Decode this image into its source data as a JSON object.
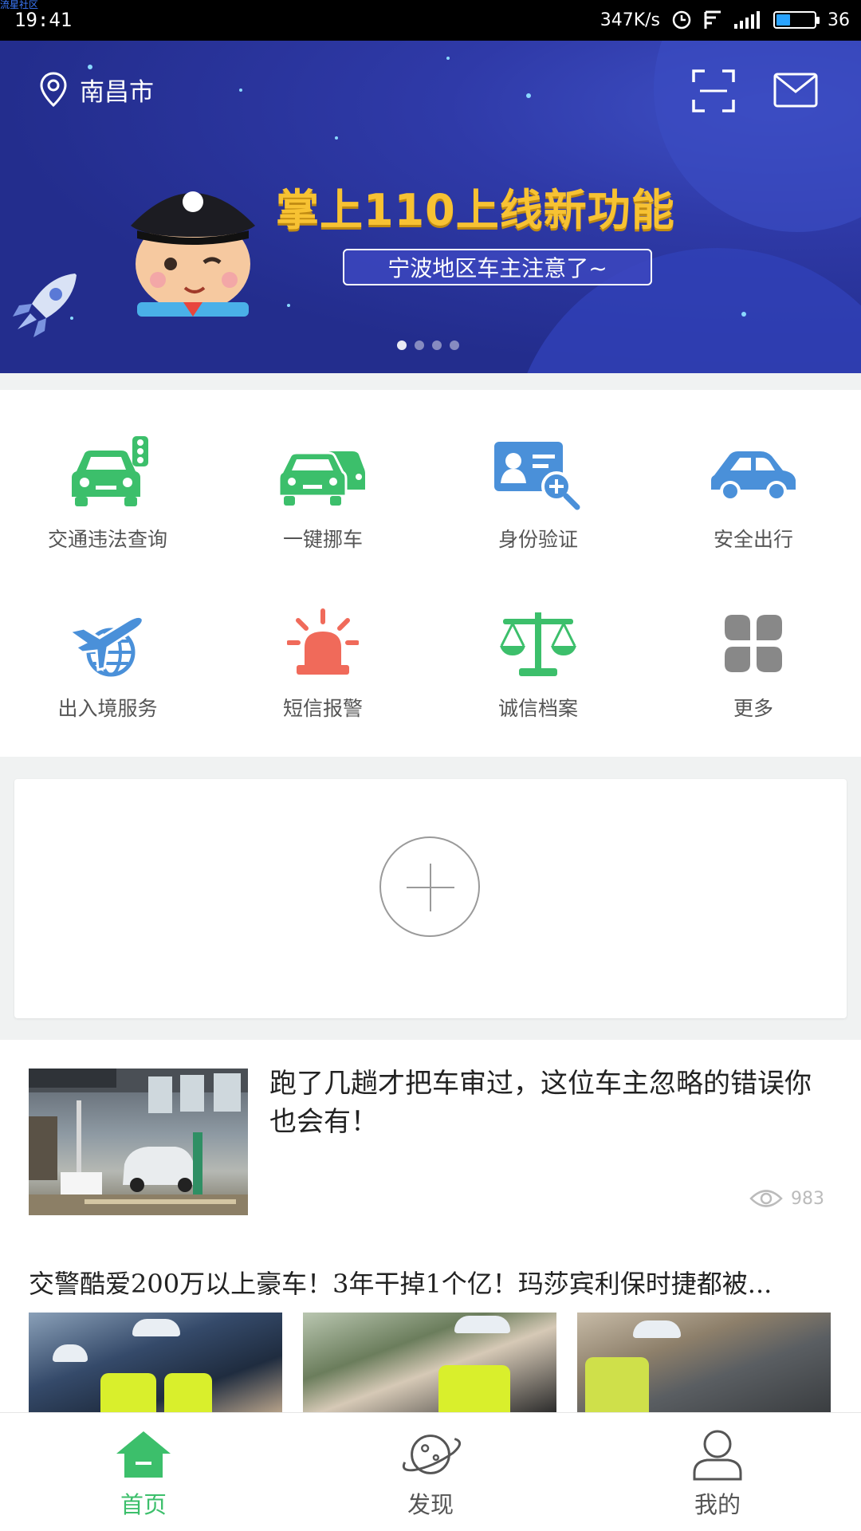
{
  "watermark": "流星社区",
  "status_bar": {
    "time": "19:41",
    "network_speed": "347K/s",
    "battery_level": "36",
    "battery_fraction": 0.36,
    "icons": [
      "alarm-icon",
      "signal-f-icon",
      "cell-signal-icon",
      "battery-icon"
    ]
  },
  "banner": {
    "location": "南昌市",
    "headline": "掌上110上线新功能",
    "subline": "宁波地区车主注意了~",
    "page_count": 4,
    "active_page": 1,
    "colors": {
      "background": "#232d8d",
      "headline": "#f7c233"
    }
  },
  "features": [
    {
      "label": "交通违法查询",
      "icon": "car-traffic-light-icon",
      "color": "#3cbf6b"
    },
    {
      "label": "一键挪车",
      "icon": "two-cars-icon",
      "color": "#3cbf6b"
    },
    {
      "label": "身份验证",
      "icon": "id-card-search-icon",
      "color": "#4a90d9"
    },
    {
      "label": "安全出行",
      "icon": "car-icon",
      "color": "#4a90d9"
    },
    {
      "label": "出入境服务",
      "icon": "plane-globe-icon",
      "color": "#4a90d9"
    },
    {
      "label": "短信报警",
      "icon": "alarm-light-icon",
      "color": "#f06a5a"
    },
    {
      "label": "诚信档案",
      "icon": "scales-icon",
      "color": "#3cbf6b"
    },
    {
      "label": "更多",
      "icon": "more-grid-icon",
      "color": "#888888"
    }
  ],
  "news": [
    {
      "title": "跑了几趟才把车审过，这位车主忽略的错误你也会有！",
      "views": "983"
    },
    {
      "title": "交警酷爱200万以上豪车！3年干掉1个亿！玛莎宾利保时捷都被..."
    }
  ],
  "tabs": [
    {
      "label": "首页",
      "icon": "home-icon",
      "active": true
    },
    {
      "label": "发现",
      "icon": "planet-icon",
      "active": false
    },
    {
      "label": "我的",
      "icon": "profile-icon",
      "active": false
    }
  ],
  "colors": {
    "accent": "#3cbf6b",
    "inactive": "#555555"
  }
}
